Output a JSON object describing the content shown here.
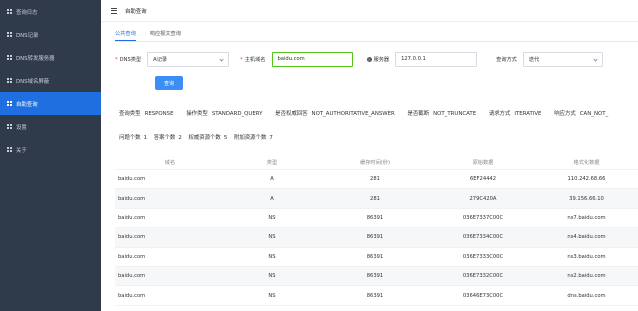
{
  "sidebar": {
    "items": [
      {
        "label": "查询日志",
        "active": false
      },
      {
        "label": "DNS记录",
        "active": false
      },
      {
        "label": "DNS转发服务器",
        "active": false
      },
      {
        "label": "DNS域名屏蔽",
        "active": false
      },
      {
        "label": "自助查询",
        "active": true
      },
      {
        "label": "设置",
        "active": false
      },
      {
        "label": "关于",
        "active": false
      }
    ]
  },
  "header": {
    "title": "自助查询"
  },
  "tabs": [
    {
      "label": "公共查询",
      "active": true
    },
    {
      "label": "响应报文查询",
      "active": false
    }
  ],
  "form": {
    "dns_type_label": "DNS类型",
    "dns_type_value": "A记录",
    "host_label": "主机域名",
    "host_value": "baidu.com",
    "server_label": "服务器",
    "server_value": "127.0.0.1",
    "mode_label": "查询方式",
    "mode_value": "迭代",
    "query_button": "查询"
  },
  "flags": [
    {
      "key": "查询类型",
      "value": "RESPONSE"
    },
    {
      "key": "操作类型",
      "value": "STANDARD_QUERY"
    },
    {
      "key": "是否权威回答",
      "value": "NOT_AUTHORITATIVE_ANSWER"
    },
    {
      "key": "是否截断",
      "value": "NOT_TRUNCATE"
    },
    {
      "key": "请求方式",
      "value": "ITERATIVE"
    },
    {
      "key": "响应方式",
      "value": "CAN_NOT_"
    }
  ],
  "counts": [
    {
      "key": "问题个数",
      "value": "1"
    },
    {
      "key": "答案个数",
      "value": "2"
    },
    {
      "key": "权威资源个数",
      "value": "5"
    },
    {
      "key": "附加资源个数",
      "value": "7"
    }
  ],
  "table": {
    "headers": [
      "域名",
      "类型",
      "缓存时间(秒)",
      "原始数据",
      "格式化数据"
    ],
    "rows": [
      [
        "baidu.com",
        "A",
        "281",
        "6EF24442",
        "110.242.68.66"
      ],
      [
        "baidu.com",
        "A",
        "281",
        "279C420A",
        "39.156.66.10"
      ],
      [
        "baidu.com",
        "NS",
        "86391",
        "036E7337C00C",
        "ns7.baidu.com"
      ],
      [
        "baidu.com",
        "NS",
        "86391",
        "036E7334C00C",
        "ns4.baidu.com"
      ],
      [
        "baidu.com",
        "NS",
        "86391",
        "036E7333C00C",
        "ns3.baidu.com"
      ],
      [
        "baidu.com",
        "NS",
        "86391",
        "036E7332C00C",
        "ns2.baidu.com"
      ],
      [
        "baidu.com",
        "NS",
        "86391",
        "03646E73C00C",
        "dns.baidu.com"
      ]
    ]
  },
  "colors": {
    "sidebar_bg": "#2f3a4a",
    "active_blue": "#1f6fe0",
    "button_blue": "#3a8ef6",
    "focus_green": "#52c41a"
  },
  "icons": {
    "sidebar_item": "grid-icon",
    "header": "menu-icon",
    "server": "info-icon",
    "select": "chevron-down-icon"
  }
}
